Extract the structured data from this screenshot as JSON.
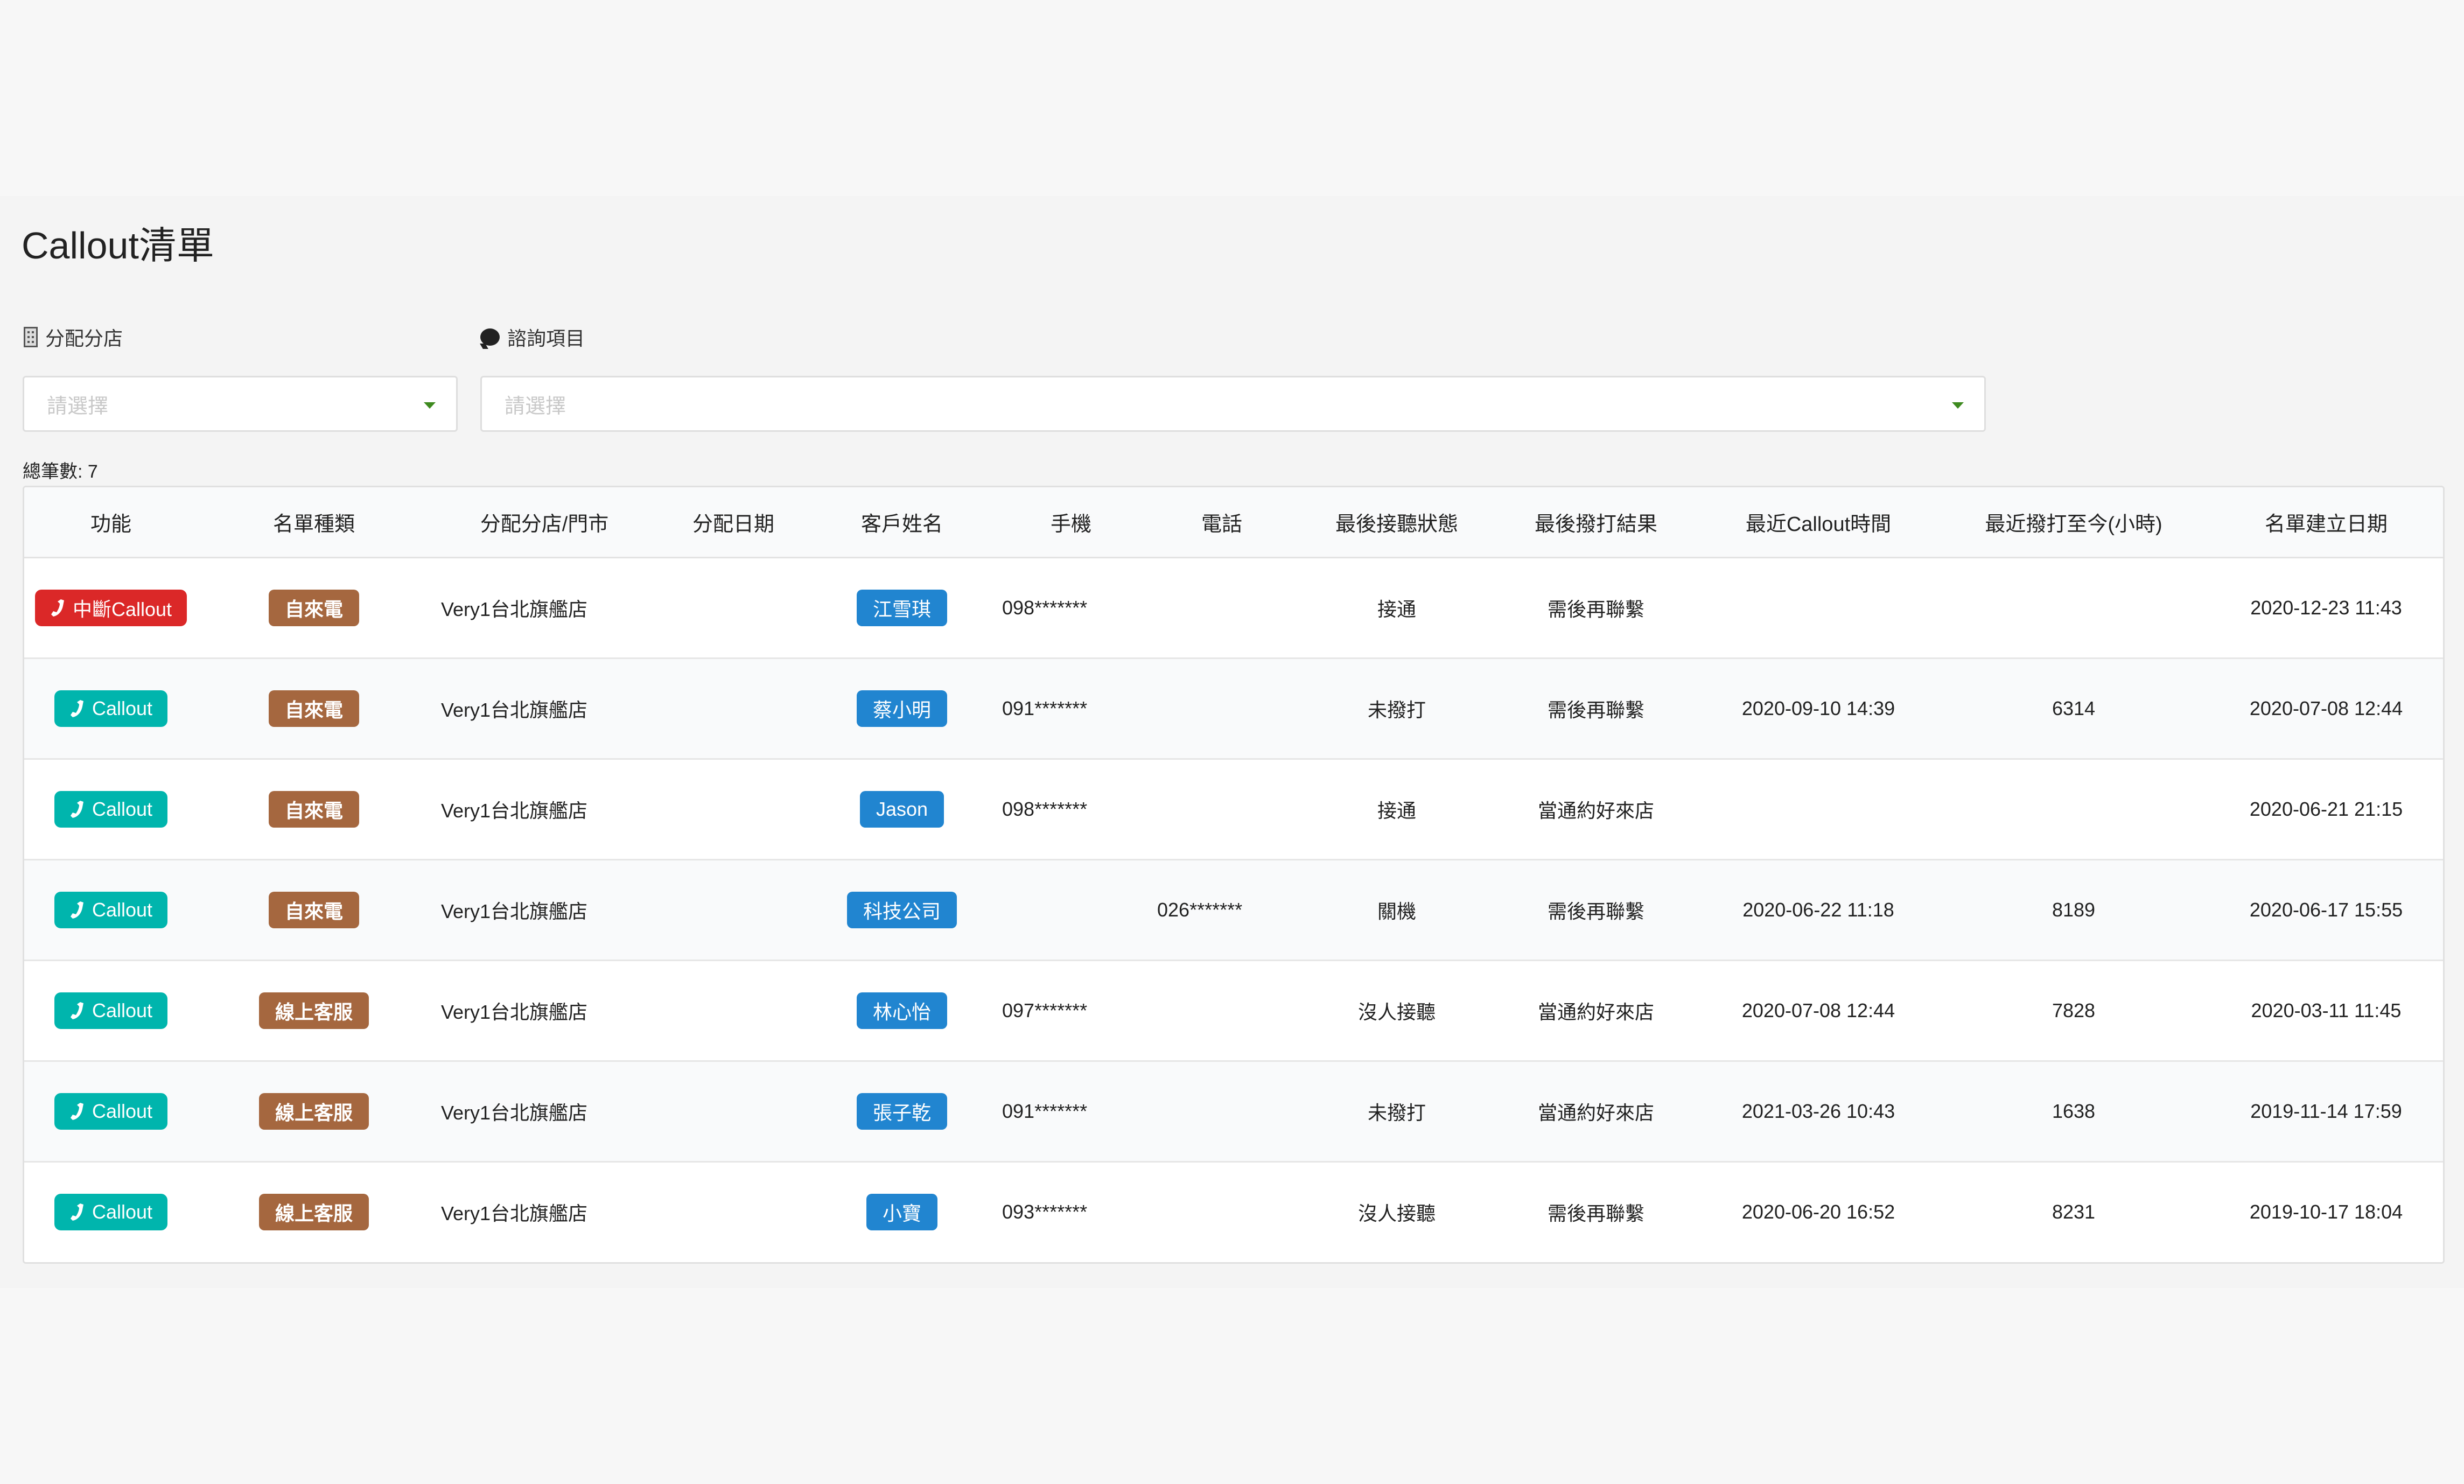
{
  "page": {
    "title": "Callout清單"
  },
  "filters": {
    "branch": {
      "icon": "building-icon",
      "label": "分配分店",
      "placeholder": "請選擇"
    },
    "inquiry": {
      "icon": "comment-icon",
      "label": "諮詢項目",
      "placeholder": "請選擇"
    }
  },
  "summary": {
    "total_label": "總筆數: 7"
  },
  "colors": {
    "callout_button": "#00b5ad",
    "interrupt_button": "#db2828",
    "list_type_badge": "#a5673f",
    "customer_badge": "#2185d0",
    "dropdown_caret": "#3e8a1f"
  },
  "table": {
    "columns": [
      "功能",
      "名單種類",
      "分配分店/門市",
      "分配日期",
      "客戶姓名",
      "手機",
      "電話",
      "最後接聽狀態",
      "最後撥打結果",
      "最近Callout時間",
      "最近撥打至今(小時)",
      "名單建立日期"
    ],
    "rows": [
      {
        "action": "中斷Callout",
        "action_type": "interrupt",
        "list_type": "自來電",
        "store": "Very1台北旗艦店",
        "assign_date": "",
        "customer": "江雪琪",
        "mobile": "098*******",
        "phone": "",
        "answer_status": "接通",
        "call_result": "需後再聯繫",
        "last_callout": "",
        "hours_since": "",
        "created": "2020-12-23 11:43"
      },
      {
        "action": "Callout",
        "action_type": "callout",
        "list_type": "自來電",
        "store": "Very1台北旗艦店",
        "assign_date": "",
        "customer": "蔡小明",
        "mobile": "091*******",
        "phone": "",
        "answer_status": "未撥打",
        "call_result": "需後再聯繫",
        "last_callout": "2020-09-10 14:39",
        "hours_since": "6314",
        "created": "2020-07-08 12:44"
      },
      {
        "action": "Callout",
        "action_type": "callout",
        "list_type": "自來電",
        "store": "Very1台北旗艦店",
        "assign_date": "",
        "customer": "Jason",
        "mobile": "098*******",
        "phone": "",
        "answer_status": "接通",
        "call_result": "當通約好來店",
        "last_callout": "",
        "hours_since": "",
        "created": "2020-06-21 21:15"
      },
      {
        "action": "Callout",
        "action_type": "callout",
        "list_type": "自來電",
        "store": "Very1台北旗艦店",
        "assign_date": "",
        "customer": "科技公司",
        "mobile": "",
        "phone": "026*******",
        "answer_status": "關機",
        "call_result": "需後再聯繫",
        "last_callout": "2020-06-22 11:18",
        "hours_since": "8189",
        "created": "2020-06-17 15:55"
      },
      {
        "action": "Callout",
        "action_type": "callout",
        "list_type": "線上客服",
        "store": "Very1台北旗艦店",
        "assign_date": "",
        "customer": "林心怡",
        "mobile": "097*******",
        "phone": "",
        "answer_status": "沒人接聽",
        "call_result": "當通約好來店",
        "last_callout": "2020-07-08 12:44",
        "hours_since": "7828",
        "created": "2020-03-11 11:45"
      },
      {
        "action": "Callout",
        "action_type": "callout",
        "list_type": "線上客服",
        "store": "Very1台北旗艦店",
        "assign_date": "",
        "customer": "張子乾",
        "mobile": "091*******",
        "phone": "",
        "answer_status": "未撥打",
        "call_result": "當通約好來店",
        "last_callout": "2021-03-26 10:43",
        "hours_since": "1638",
        "created": "2019-11-14 17:59"
      },
      {
        "action": "Callout",
        "action_type": "callout",
        "list_type": "線上客服",
        "store": "Very1台北旗艦店",
        "assign_date": "",
        "customer": "小寶",
        "mobile": "093*******",
        "phone": "",
        "answer_status": "沒人接聽",
        "call_result": "需後再聯繫",
        "last_callout": "2020-06-20 16:52",
        "hours_since": "8231",
        "created": "2019-10-17 18:04"
      }
    ]
  }
}
